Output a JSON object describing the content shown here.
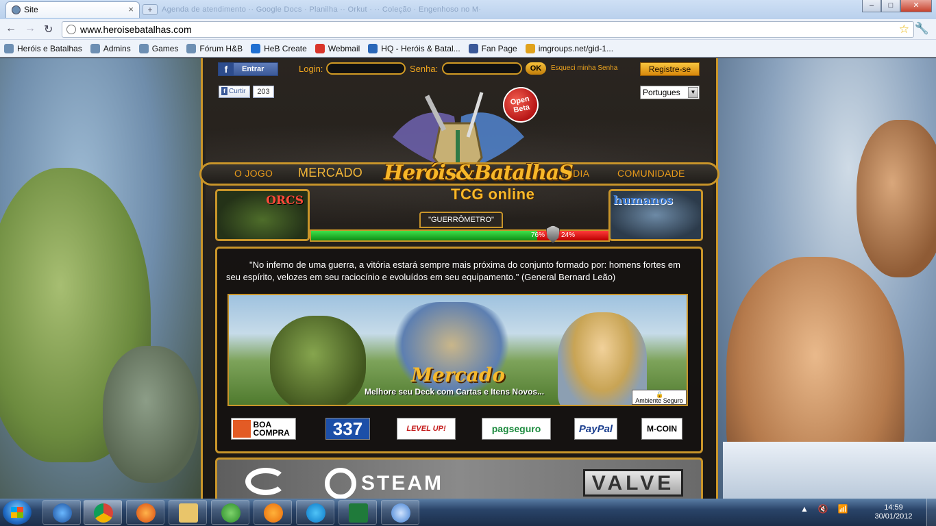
{
  "browser": {
    "tab_title": "Site",
    "tab_close": "×",
    "new_tab": "+",
    "ghost_tabs": "Agenda de atendimento ·· Google Docs · Planilha ·· Orkut · ·· Coleção · Engenhoso no M·",
    "address": "www.heroisebatalhas.com",
    "win_min": "–",
    "win_max": "□",
    "win_close": "✕",
    "bookmarks": [
      {
        "label": "Heróis e Batalhas",
        "icon": "globe-icon",
        "color": "#6d8fb3"
      },
      {
        "label": "Admins",
        "icon": "globe-icon",
        "color": "#6d8fb3"
      },
      {
        "label": "Games",
        "icon": "globe-icon",
        "color": "#6d8fb3"
      },
      {
        "label": "Fórum H&B",
        "icon": "globe-icon",
        "color": "#6d8fb3"
      },
      {
        "label": "HeB Create",
        "icon": "x-icon",
        "color": "#1f6fd1"
      },
      {
        "label": "Webmail",
        "icon": "mail-icon",
        "color": "#d9352a"
      },
      {
        "label": "HQ - Heróis & Batal...",
        "icon": "hq-icon",
        "color": "#2a67b8"
      },
      {
        "label": "Fan Page",
        "icon": "facebook-icon",
        "color": "#3b5998"
      },
      {
        "label": "imgroups.net/gid-1...",
        "icon": "imgroups-icon",
        "color": "#e0a21c"
      }
    ]
  },
  "header": {
    "fb_login": "Entrar",
    "login_label": "Login:",
    "password_label": "Senha:",
    "login_value": "",
    "password_value": "",
    "ok": "OK",
    "forgot": "Esqueci minha Senha",
    "register": "Registre-se",
    "like": "Curtir",
    "like_count": "203",
    "language": "Portugues",
    "open_beta": "Open Beta"
  },
  "nav": {
    "items": [
      "O JOGO",
      "MERCADO",
      "MÍDIA",
      "COMUNIDADE"
    ],
    "brand": "Heróis&BatalhaS",
    "subbrand": "TCG online"
  },
  "war": {
    "orcs_label": "ORCS",
    "humans_label": "humanos",
    "meter_label": "\"GUERRÔMETRO\"",
    "orcs_pct": "76%",
    "humans_pct": "24%",
    "orcs_value": 76,
    "humans_value": 24
  },
  "main": {
    "quote": "\"No inferno de uma guerra, a vitória estará sempre mais próxima do conjunto formado por: homens fortes em seu espírito, velozes em seu raciocínio e evoluídos em seu equipamento.\" (General Bernard Leão)",
    "banner_title": "Mercado",
    "banner_subtitle": "Melhore seu Deck com Cartas e Itens Novos...",
    "safe_label": "Ambiente Seguro",
    "payments": [
      "BOA COMPRA",
      "337",
      "LEVEL UP!",
      "pagseguro",
      "PayPal",
      "M-COIN"
    ]
  },
  "steam": {
    "steam_label": "STEAM",
    "valve_label": "VALVE"
  },
  "taskbar": {
    "time": "14:59",
    "date": "30/01/2012",
    "tray_arrow": "▲"
  }
}
